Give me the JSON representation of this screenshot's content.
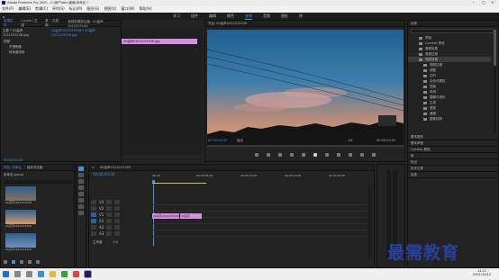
{
  "app": {
    "title": "Adobe Premiere Pro 2020 - C:\\用户\\bbc\\桌面\\未命名 *"
  },
  "menu": [
    "文件(F)",
    "编辑(E)",
    "剪辑(C)",
    "序列(S)",
    "标记(M)",
    "图形(G)",
    "视图(V)",
    "窗口(W)",
    "帮助(H)"
  ],
  "workspaces": [
    "学习",
    "组件",
    "编辑",
    "颜色",
    "效果",
    "音频",
    "图形",
    "库"
  ],
  "active_workspace": "效果",
  "effect_controls": {
    "tabs": [
      "效果控件",
      "Lumetri 范围",
      "源：(无剪辑)",
      "音频剪辑混合器：00高声2021033108"
    ],
    "source_label": "主要 * 00高声2021033108.jpg",
    "seq_label": "00高声2021033108 * 00高声2021033108.jpg",
    "clip_name": "00高声2021033108.jpg",
    "sections": [
      "视频",
      "不透明度",
      "时间重映射"
    ],
    "timecode": "00:00:00:00"
  },
  "program": {
    "title": "节目: 00高声2021033108",
    "tc_left": "00:00:00:00",
    "fit": "适合",
    "ratio": "1/2",
    "tc_right": "00:00:03:03"
  },
  "project": {
    "tabs": [
      "项目: 未命名",
      "媒体浏览器"
    ],
    "name": "未命名.prproj",
    "items": [
      {
        "label": "00高声2021033108",
        "color": "#8a6f5a"
      },
      {
        "label": "00高声2021033108",
        "color": "#d79a6a"
      },
      {
        "label": "00高声2021033108",
        "color": "#6f8fb8"
      }
    ]
  },
  "timeline": {
    "title": "00高声2021033108",
    "timecode": "00:00:00:00",
    "ruler": [
      "00:00",
      "00:00:05:00",
      "00:00:10:00",
      "00:00:15:00",
      "00:00:20:00"
    ],
    "tracks": [
      "V3",
      "V2",
      "V1",
      "A1",
      "A2",
      "A3"
    ],
    "master": "主声道",
    "master_value": "0.0",
    "clips": [
      "00高声2021033108",
      "00高声2021033"
    ]
  },
  "effects_panel": {
    "title": "效果",
    "items": [
      "预设",
      "Lumetri 预设",
      "音频效果",
      "音频过渡",
      "视频效果",
      "视频过渡",
      "调整",
      "过时",
      "杂色与颗粒",
      "扭曲",
      "时间",
      "模糊与锐化",
      "生成",
      "透视",
      "通道",
      "图像控制"
    ],
    "sections": [
      "基本图形",
      "基本声音",
      "Lumetri 颜色",
      "库",
      "标记",
      "历史记录",
      "信息"
    ]
  },
  "watermark": "最需教育",
  "clock": {
    "time": "14:21",
    "date": "2021/10/12"
  },
  "colors": {
    "accent": "#4a8fe2",
    "clip": "#d98ee2",
    "watermark": "#2a3f9e"
  }
}
